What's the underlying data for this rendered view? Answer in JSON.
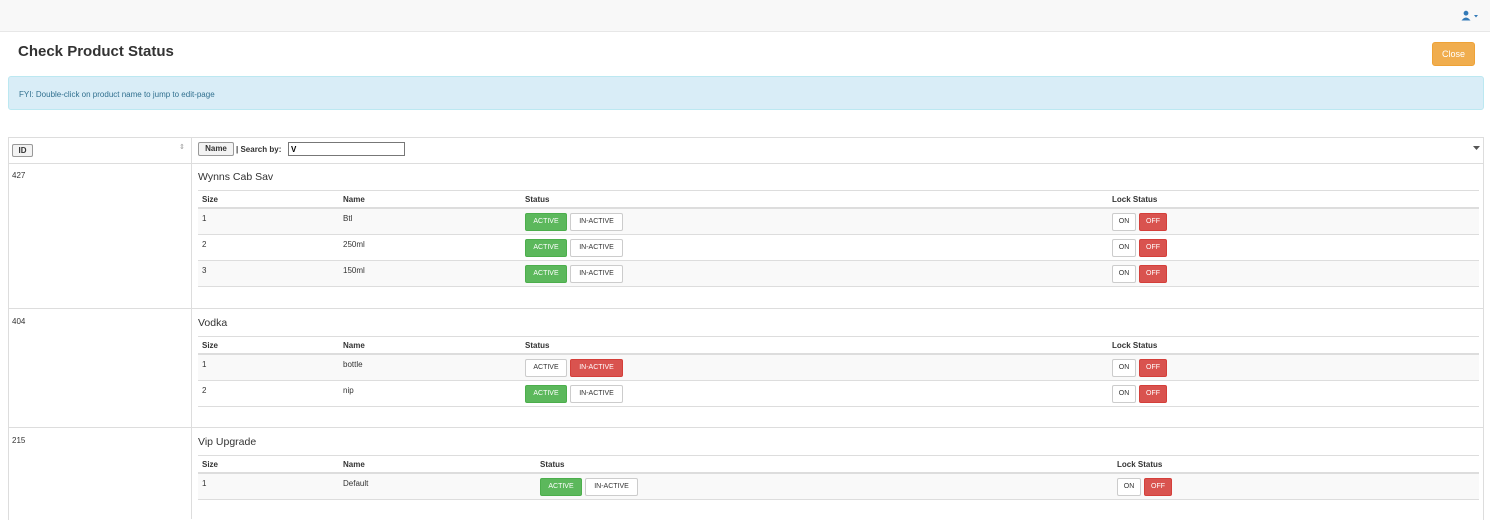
{
  "header": {
    "user_icon": "user-icon",
    "dropdown_icon": "caret-down-icon"
  },
  "page": {
    "title": "Check Product Status",
    "close_label": "Close"
  },
  "info": {
    "text": "FYI: Double-click on product name to jump to edit-page"
  },
  "table": {
    "id_button": "ID",
    "sort_icon": "sort-icon",
    "name_button": "Name",
    "search_label": "| Search by:",
    "search_value": "V",
    "sub_headers": {
      "size": "Size",
      "name": "Name",
      "status": "Status",
      "lock_status": "Lock Status"
    },
    "buttons": {
      "active": "ACTIVE",
      "inactive": "IN-ACTIVE",
      "on": "ON",
      "off": "OFF"
    },
    "products": [
      {
        "id": "427",
        "name": "Wynns Cab Sav",
        "sizes": [
          {
            "size": "1",
            "name": "Btl",
            "status": "ACTIVE",
            "lock": "OFF"
          },
          {
            "size": "2",
            "name": "250ml",
            "status": "ACTIVE",
            "lock": "OFF"
          },
          {
            "size": "3",
            "name": "150ml",
            "status": "ACTIVE",
            "lock": "OFF"
          }
        ]
      },
      {
        "id": "404",
        "name": "Vodka",
        "sizes": [
          {
            "size": "1",
            "name": "bottle",
            "status": "IN-ACTIVE",
            "lock": "OFF"
          },
          {
            "size": "2",
            "name": "nip",
            "status": "ACTIVE",
            "lock": "OFF"
          }
        ]
      },
      {
        "id": "215",
        "name": "Vip Upgrade",
        "sizes": [
          {
            "size": "1",
            "name": "Default",
            "status": "ACTIVE",
            "lock": "OFF"
          }
        ]
      }
    ]
  },
  "colors": {
    "active": "#5cb85c",
    "inactive": "#d9534f",
    "close": "#f0ad4e",
    "info_bg": "#d9edf7"
  }
}
